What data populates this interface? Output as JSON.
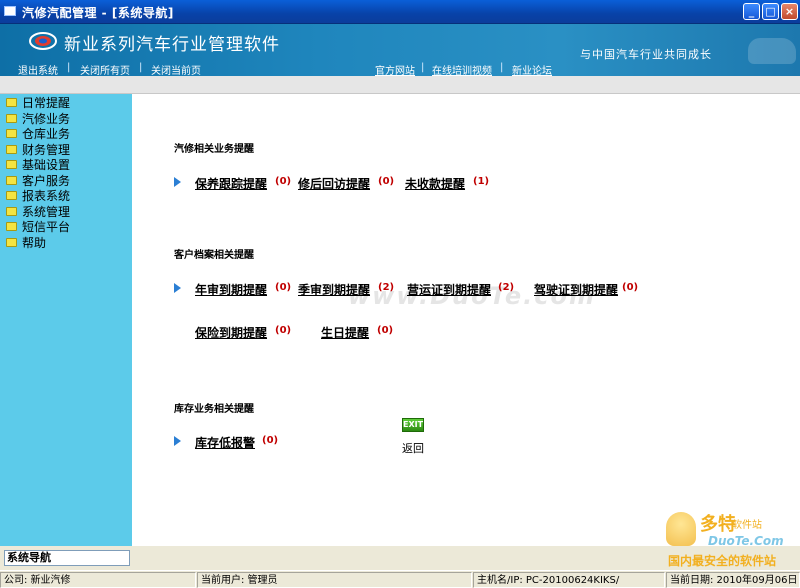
{
  "window": {
    "title": "汽修汽配管理 - [系统导航]",
    "controls": {
      "minimize": "_",
      "maximize": "□",
      "close": "×"
    }
  },
  "banner": {
    "brand": "新业系列汽车行业管理软件",
    "slogan": "与中国汽车行业共同成长",
    "nav_left": [
      "退出系统",
      "关闭所有页",
      "关闭当前页"
    ],
    "nav_right": [
      "官方网站",
      "在线培训视频",
      "新业论坛"
    ],
    "separator": "|"
  },
  "sidebar": {
    "items": [
      {
        "label": "日常提醒"
      },
      {
        "label": "汽修业务"
      },
      {
        "label": "仓库业务"
      },
      {
        "label": "财务管理"
      },
      {
        "label": "基础设置"
      },
      {
        "label": "客户服务"
      },
      {
        "label": "报表系统"
      },
      {
        "label": "系统管理"
      },
      {
        "label": "短信平台"
      },
      {
        "label": "帮助"
      }
    ]
  },
  "main": {
    "sections": {
      "repair": {
        "title": "汽修相关业务提醒",
        "items": [
          {
            "label": "保养跟踪提醒",
            "count": "(0)"
          },
          {
            "label": "修后回访提醒",
            "count": "(0)"
          },
          {
            "label": "未收款提醒",
            "count": "(1)"
          }
        ]
      },
      "customer": {
        "title": "客户档案相关提醒",
        "items": [
          {
            "label": "年审到期提醒",
            "count": "(0)"
          },
          {
            "label": "季审到期提醒",
            "count": "(2)"
          },
          {
            "label": "营运证到期提醒",
            "count": "(2)"
          },
          {
            "label": "驾驶证到期提醒",
            "count": "(0)"
          },
          {
            "label": "保险到期提醒",
            "count": "(0)"
          },
          {
            "label": "生日提醒",
            "count": "(0)"
          }
        ]
      },
      "stock": {
        "title": "库存业务相关提醒",
        "items": [
          {
            "label": "库存低报警",
            "count": "(0)"
          }
        ]
      }
    },
    "exit_button": "EXIT",
    "back_label": "返回",
    "watermark": "www.DuoTe.com"
  },
  "footer": {
    "nav_box": "系统导航",
    "status": {
      "company": "公司:   新业汽修",
      "user": "当前用户: 管理员",
      "host": "主机名/IP: PC-20100624KIKS/",
      "date": "当前日期: 2010年09月06日"
    },
    "badge": {
      "brand": "多特",
      "sub": "软件站",
      "url": "DuoTe.Com",
      "tag": "国内最安全的软件站"
    }
  },
  "colors": {
    "sidebar_bg": "#5ccbea",
    "banner_bg": "#1f86bd",
    "count_red": "#c00000",
    "arrow_blue": "#2b7fd4"
  }
}
